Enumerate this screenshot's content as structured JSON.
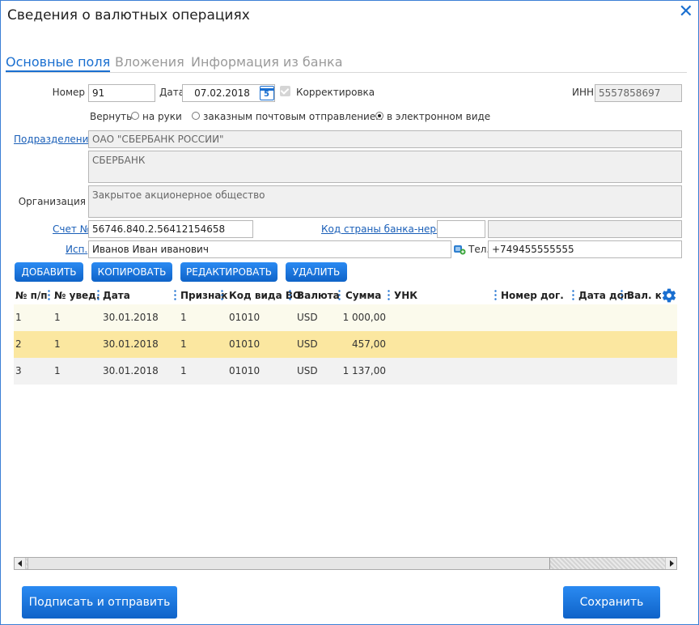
{
  "window": {
    "title": "Сведения о валютных операциях",
    "close_glyph": "✕"
  },
  "tabs": [
    {
      "label": "Основные поля",
      "active": true
    },
    {
      "label": "Вложения",
      "active": false
    },
    {
      "label": "Информация из банка",
      "active": false
    }
  ],
  "form": {
    "number_label": "Номер",
    "number_value": "91",
    "date_label": "Дата",
    "date_value": "07.02.2018",
    "calendar_glyph": "5",
    "correction_label": "Корректировка",
    "correction_checked": true,
    "inn_label": "ИНН",
    "inn_value": "5557858697",
    "return_label": "Вернуть",
    "return_options": [
      {
        "label": "на руки",
        "selected": false
      },
      {
        "label": "заказным почтовым отправлением",
        "selected": false
      },
      {
        "label": "в электронном виде",
        "selected": true
      }
    ],
    "division_label": "Подразделение",
    "division_value": "ОАО \"СБЕРБАНК РОССИИ\"",
    "bank_value": "СБЕРБАНК",
    "organization_label": "Организация",
    "organization_value": "Закрытое акционерное общество",
    "account_label": "Счет №",
    "account_value": "56746.840.2.56412154658",
    "country_code_label": "Код страны банка-нерез.",
    "country_code_value": "",
    "country_name_value": "",
    "executor_label": "Исп.",
    "executor_value": "Иванов Иван иванович",
    "phone_label": "Тел.",
    "phone_value": "+749455555555"
  },
  "toolbar": {
    "add_label": "ДОБАВИТЬ",
    "copy_label": "КОПИРОВАТЬ",
    "edit_label": "РЕДАКТИРОВАТЬ",
    "delete_label": "УДАЛИТЬ"
  },
  "table": {
    "columns": [
      "№ п/п",
      "№ увед.",
      "Дата",
      "Признак",
      "Код вида ВО",
      "Валюта",
      "Сумма",
      "УНК",
      "Номер дог.",
      "Дата дог.",
      "Вал. ко"
    ],
    "rows": [
      [
        "1",
        "1",
        "30.01.2018",
        "1",
        "01010",
        "USD",
        "1 000,00",
        "",
        "",
        "",
        ""
      ],
      [
        "2",
        "1",
        "30.01.2018",
        "1",
        "01010",
        "USD",
        "457,00",
        "",
        "",
        "",
        ""
      ],
      [
        "3",
        "1",
        "30.01.2018",
        "1",
        "01010",
        "USD",
        "1 137,00",
        "",
        "",
        "",
        ""
      ]
    ],
    "selected_row": 2,
    "settings_icon": "gear-icon"
  },
  "footer": {
    "sign_send_label": "Подписать и отправить",
    "save_label": "Сохранить"
  },
  "colors": {
    "accent": "#1a6fd0",
    "selected_row": "#fbe7a0",
    "button_gradient_top": "#2a8af2",
    "button_gradient_bottom": "#0f63c8"
  }
}
